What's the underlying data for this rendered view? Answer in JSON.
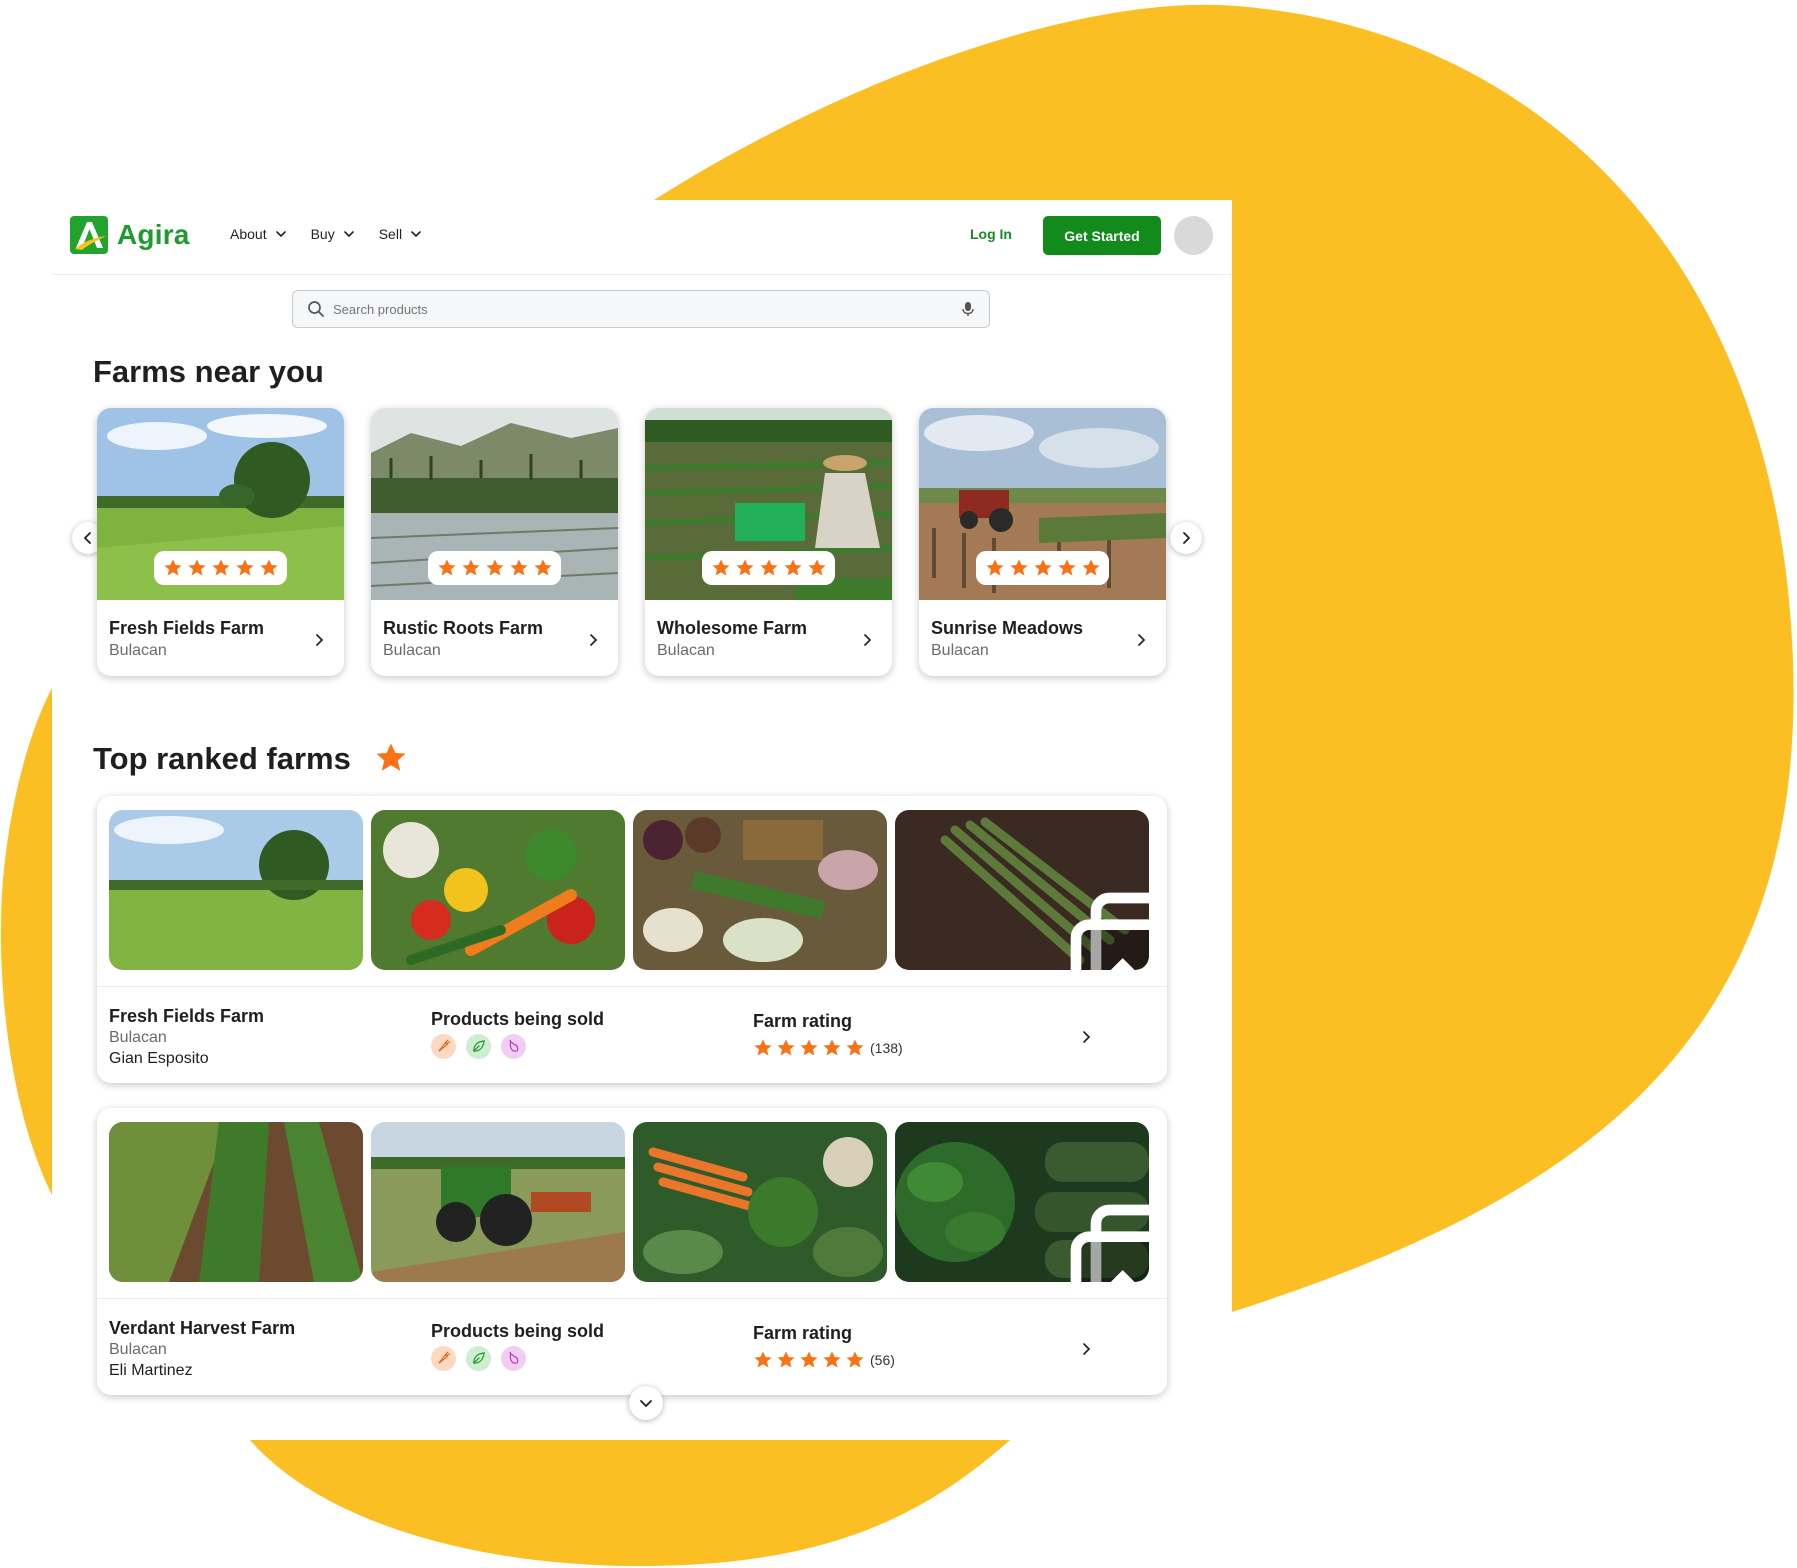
{
  "brand": {
    "name": "Agira",
    "accent": "#138a1c",
    "background_shape": "#FBBF24"
  },
  "nav": {
    "items": [
      {
        "label": "About"
      },
      {
        "label": "Buy"
      },
      {
        "label": "Sell"
      }
    ]
  },
  "header": {
    "login_label": "Log In",
    "cta_label": "Get Started"
  },
  "search": {
    "placeholder": "Search products"
  },
  "farms_near": {
    "title": "Farms near you",
    "cards": [
      {
        "name": "Fresh Fields Farm",
        "location": "Bulacan",
        "rating": 5
      },
      {
        "name": "Rustic Roots Farm",
        "location": "Bulacan",
        "rating": 5
      },
      {
        "name": "Wholesome Farm",
        "location": "Bulacan",
        "rating": 5
      },
      {
        "name": "Sunrise Meadows",
        "location": "Bulacan",
        "rating": 5
      }
    ]
  },
  "top_ranked": {
    "title": "Top ranked farms",
    "products_label": "Products being sold",
    "rating_label": "Farm rating",
    "farms": [
      {
        "name": "Fresh Fields Farm",
        "location": "Bulacan",
        "owner": "Gian Esposito",
        "rating": 5,
        "rating_count": "(138)"
      },
      {
        "name": "Verdant Harvest Farm",
        "location": "Bulacan",
        "owner": "Eli Martinez",
        "rating": 5,
        "rating_count": "(56)"
      }
    ]
  },
  "icons": {
    "star": "star-icon",
    "search": "search-icon",
    "mic": "microphone-icon",
    "gallery": "gallery-icon",
    "product_types": [
      "carrot-icon",
      "leaf-icon",
      "eggplant-icon"
    ]
  }
}
